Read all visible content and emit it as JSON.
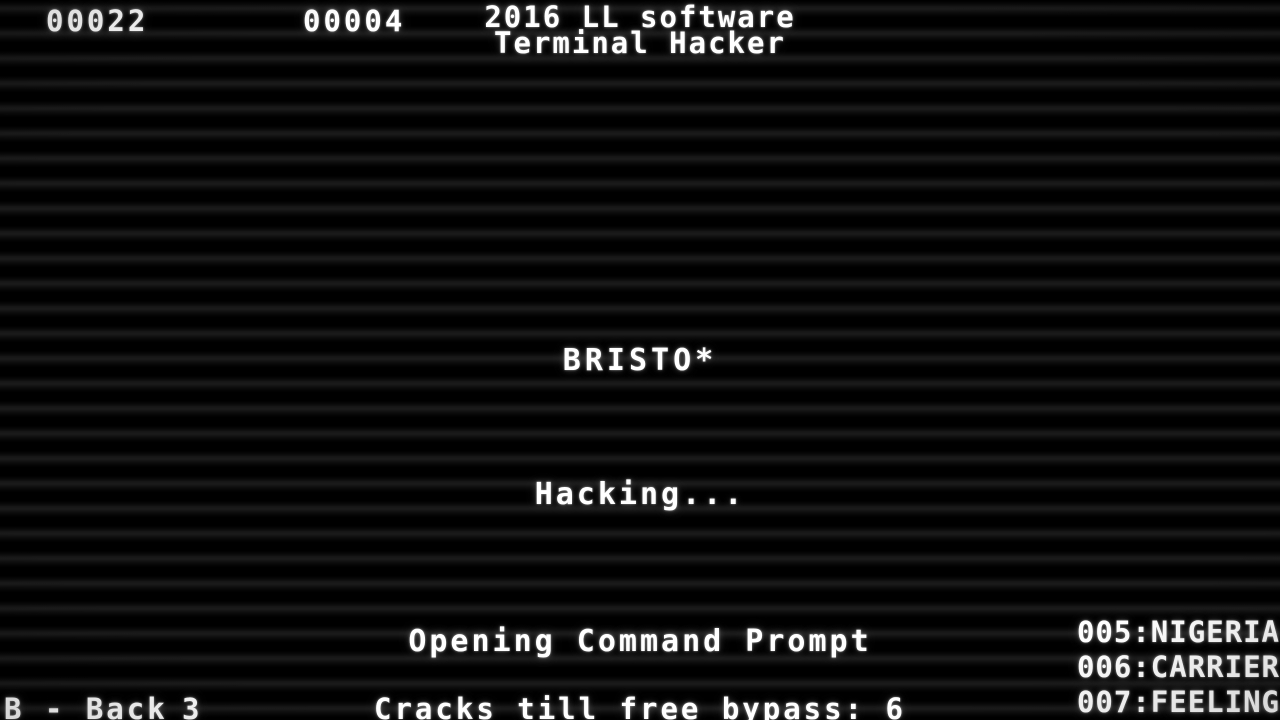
{
  "app": {
    "title_line_1": "2016 LL software",
    "title_line_2": "Terminal Hacker"
  },
  "hud": {
    "score": "00022",
    "secondary": "00004"
  },
  "main": {
    "password_guess": "BRISTO*",
    "hacking_status": "Hacking...",
    "prompt_status": "Opening Command Prompt"
  },
  "bottom": {
    "back_hint": "B - Back",
    "lives": "3",
    "cracks_label": "Cracks till free bypass: 6"
  },
  "terminal_list": {
    "entries": [
      {
        "label": "005:NIGERIA"
      },
      {
        "label": "006:CARRIER"
      },
      {
        "label": "007:FEELING"
      }
    ]
  },
  "colors": {
    "background": "#000000",
    "text": "#ffffff",
    "scanline": "#1e1e1e"
  }
}
